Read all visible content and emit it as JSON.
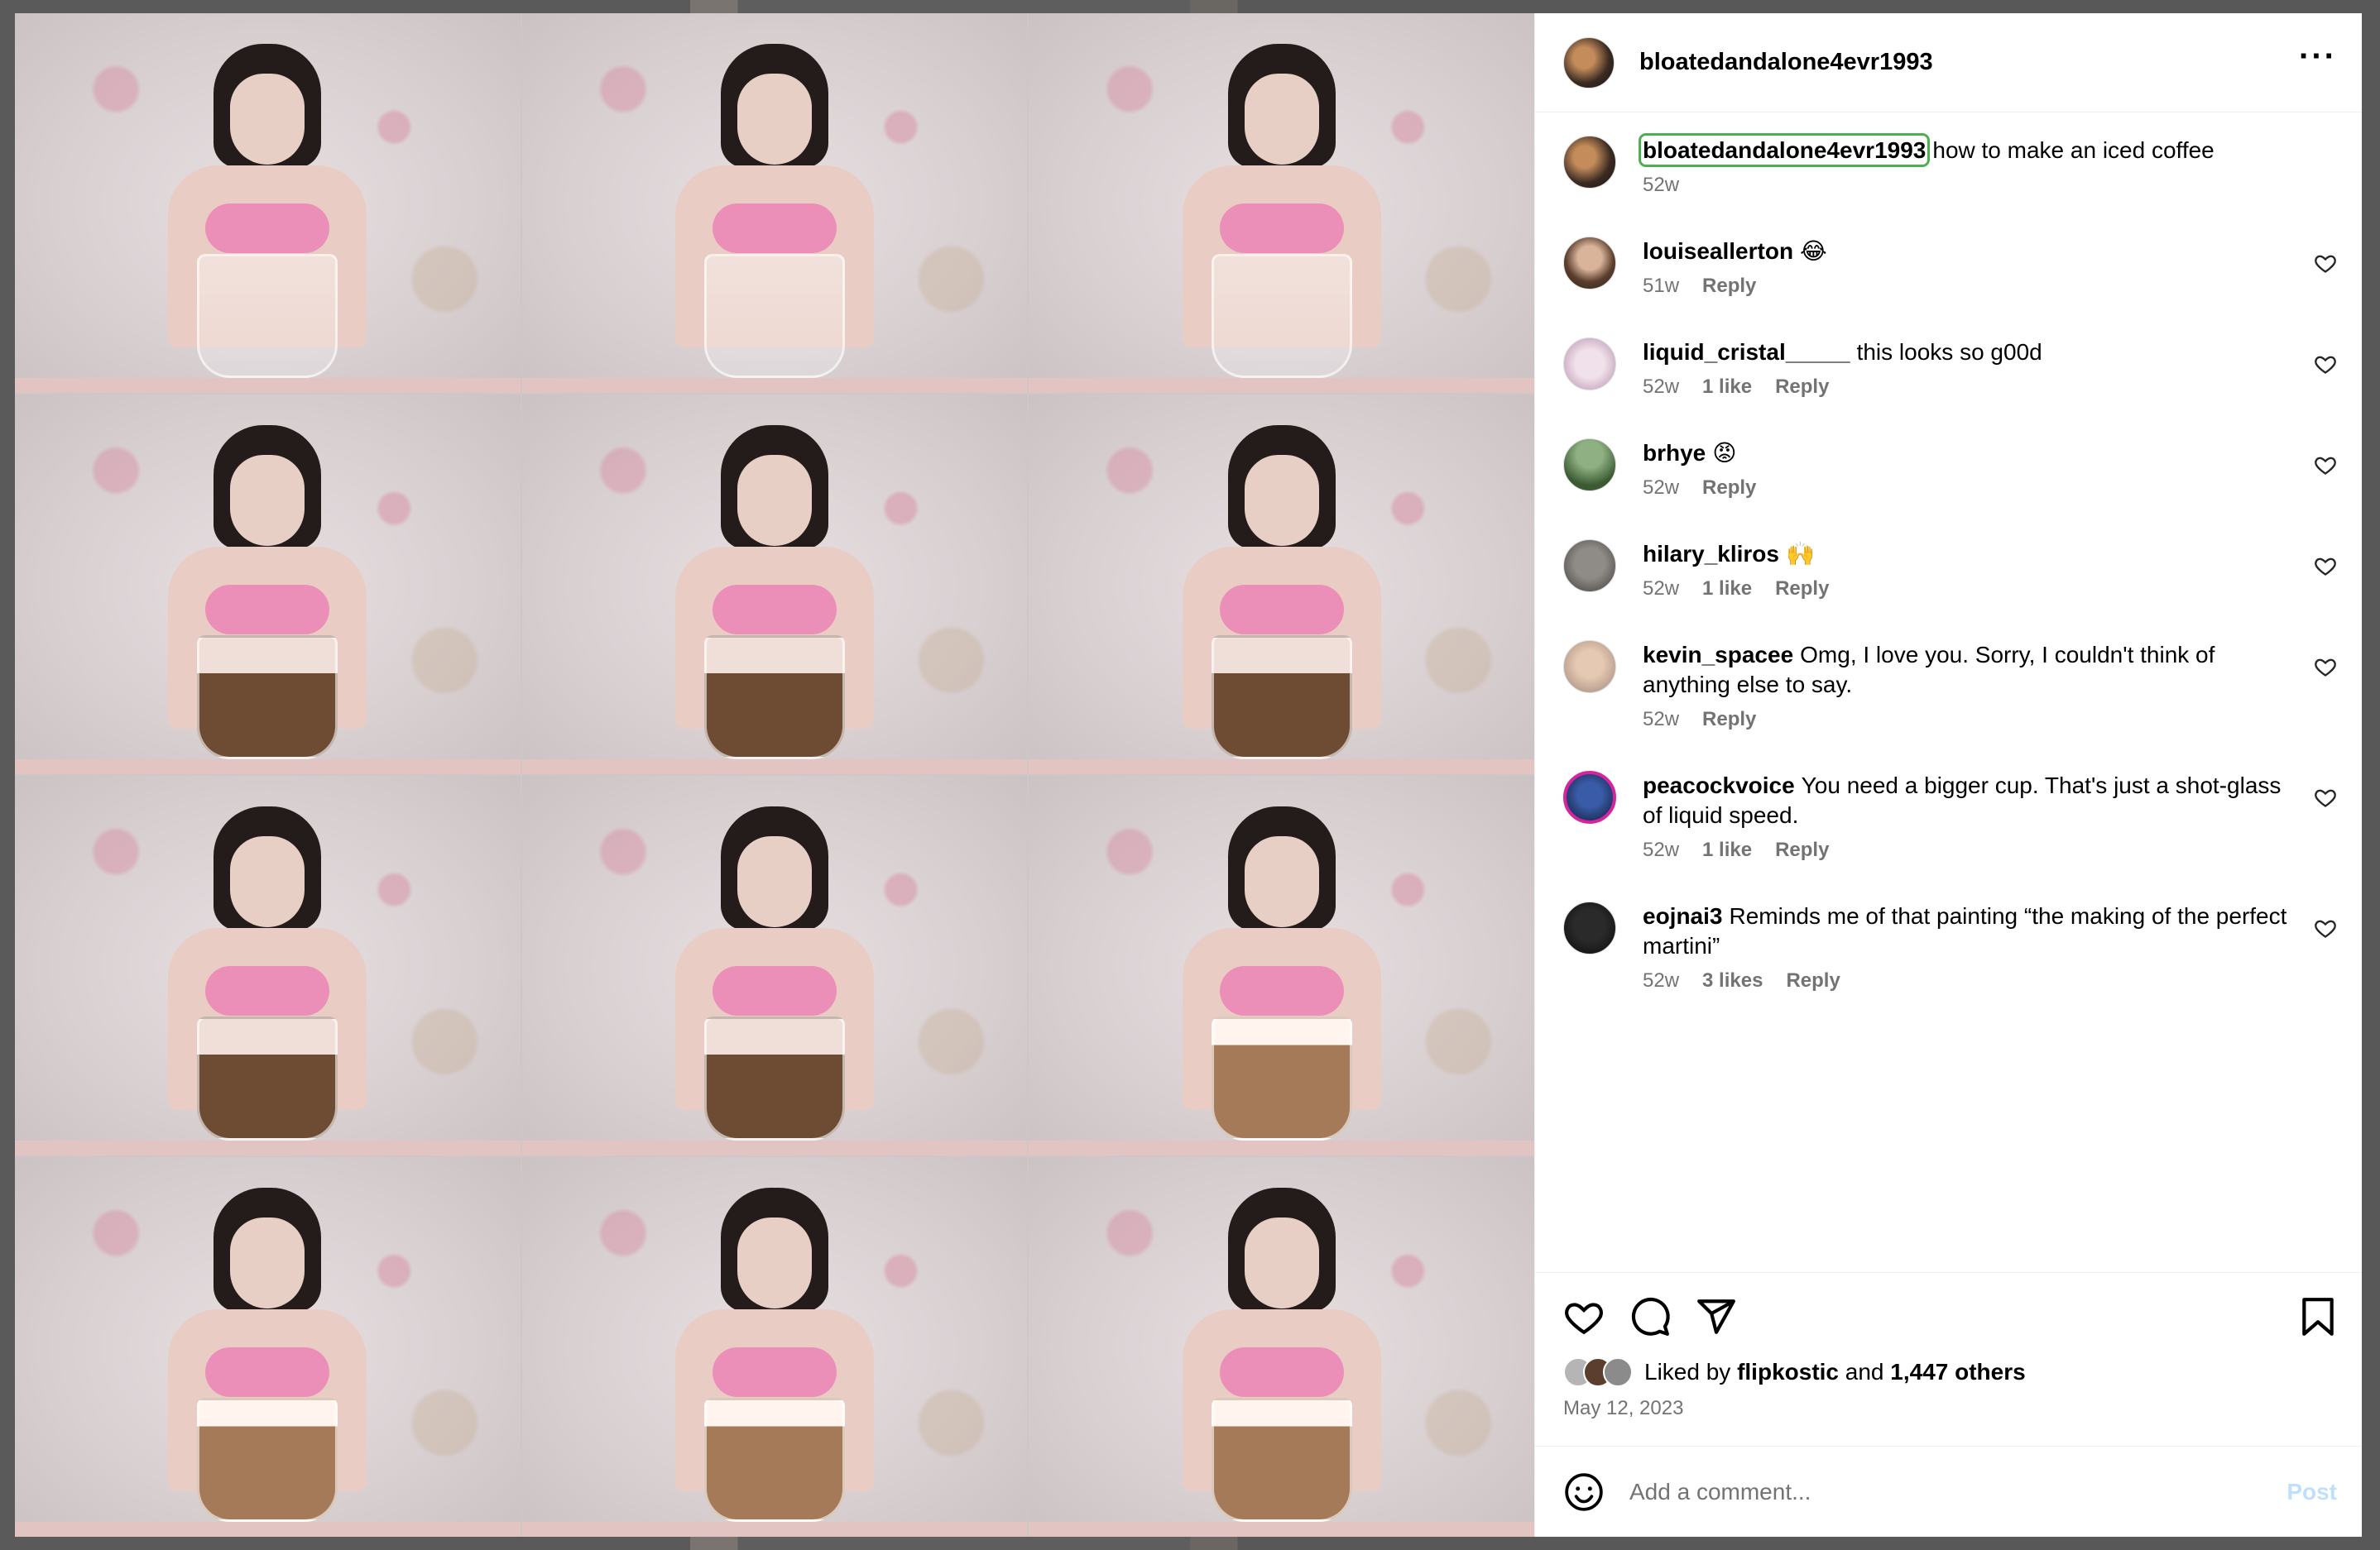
{
  "post": {
    "username": "bloatedandalone4evr1993",
    "more_label": "···"
  },
  "caption": {
    "author": "bloatedandalone4evr1993",
    "text": "how to make an iced coffee",
    "age": "52w"
  },
  "comments": [
    {
      "author": "louiseallerton",
      "text": "😂",
      "age": "51w",
      "likes": "",
      "reply": "Reply"
    },
    {
      "author": "liquid_cristal_____",
      "text": "this looks so g00d",
      "age": "52w",
      "likes": "1 like",
      "reply": "Reply"
    },
    {
      "author": "brhye",
      "text": "😡",
      "age": "52w",
      "likes": "",
      "reply": "Reply"
    },
    {
      "author": "hilary_kliros",
      "text": "🙌",
      "age": "52w",
      "likes": "1 like",
      "reply": "Reply"
    },
    {
      "author": "kevin_spacee",
      "text": "Omg, I love you. Sorry, I couldn't think of anything else to say.",
      "age": "52w",
      "likes": "",
      "reply": "Reply"
    },
    {
      "author": "peacockvoice",
      "text": "You need a bigger cup. That's just a shot-glass of liquid speed.",
      "age": "52w",
      "likes": "1 like",
      "reply": "Reply"
    },
    {
      "author": "eojnai3",
      "text": "Reminds me of that painting “the making of the perfect martini”",
      "age": "52w",
      "likes": "3 likes",
      "reply": "Reply"
    }
  ],
  "likes": {
    "prefix": "Liked by",
    "user": "flipkostic",
    "and": "and",
    "others": "1,447 others"
  },
  "date": "May 12, 2023",
  "add_comment": {
    "placeholder": "Add a comment...",
    "post_label": "Post"
  },
  "colors": {
    "accent_disabled": "#c0dffd",
    "muted": "#737373"
  },
  "icons": {
    "more": "more-icon",
    "like": "heart-icon",
    "comment": "comment-icon",
    "share": "send-icon",
    "save": "bookmark-icon",
    "emoji": "emoji-icon"
  }
}
